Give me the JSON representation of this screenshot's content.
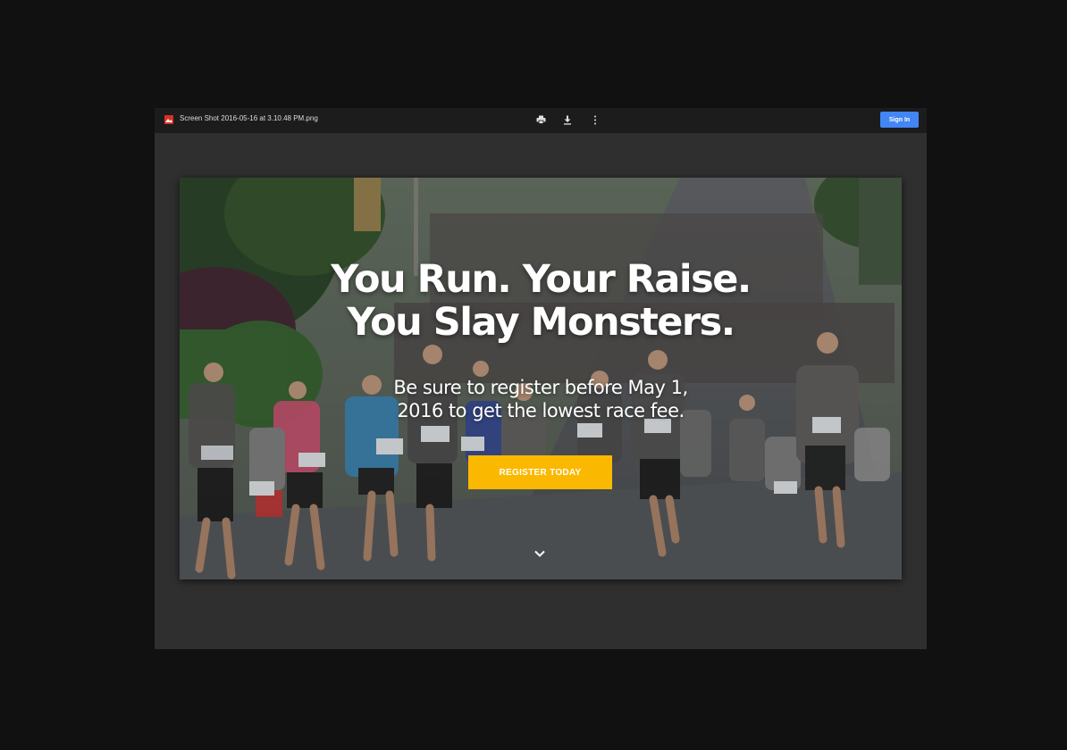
{
  "viewer": {
    "file_name": "Screen Shot 2016-05-16 at 3.10.48 PM.png",
    "sign_in_label": "Sign In",
    "icons": {
      "file": "image-file-icon",
      "print": "print-icon",
      "download": "download-icon",
      "more": "more-vert-icon"
    }
  },
  "hero": {
    "title_line1": "You Run. Your Raise.",
    "title_line2": "You Slay Monsters.",
    "subtitle_line1": "Be sure to register before May 1,",
    "subtitle_line2": "2016 to get the lowest race fee.",
    "cta_label": "REGISTER TODAY",
    "scroll_icon": "chevron-down-icon"
  },
  "colors": {
    "page_bg": "#111111",
    "viewer_bg": "#2f2f2f",
    "toolbar_bg": "#1c1c1c",
    "sign_in": "#4285f4",
    "cta": "#fbb800",
    "file_icon": "#d93025"
  }
}
